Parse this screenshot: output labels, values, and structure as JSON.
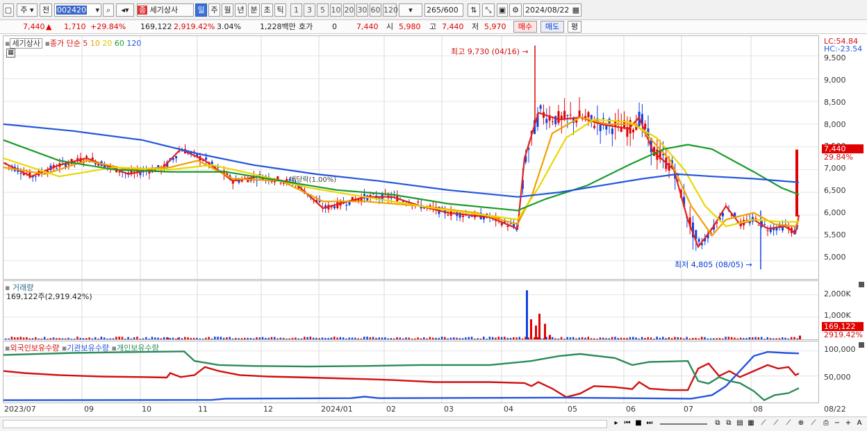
{
  "toolbar": {
    "mode_label": "주",
    "prev_label": "전",
    "code_value": "002420",
    "stock_badge": "종",
    "stock_name": "세기상사",
    "period_tabs": [
      "일",
      "주",
      "월",
      "년",
      "분",
      "초",
      "틱"
    ],
    "selected_period": "일",
    "interval_buttons": [
      "1",
      "3",
      "5",
      "10",
      "20",
      "30",
      "60",
      "120"
    ],
    "count_value": "265",
    "count_total": "/600",
    "date_value": "2024/08/22"
  },
  "quote": {
    "price": "7,440",
    "change": "1,710",
    "change_pct": "+29.84%",
    "volume": "169,122",
    "volume_pct": "2,919.42%",
    "turnover_pct": "3.04%",
    "amount": "1,228백만",
    "hoga_label": "호가",
    "hoga_value": "0",
    "ask_price": "7,440",
    "open_label": "시",
    "open": "5,980",
    "high_label": "고",
    "high": "7,440",
    "low_label": "저",
    "low": "5,970",
    "buy_btn": "매수",
    "sell_btn": "매도",
    "eval_btn": "평"
  },
  "price_panel": {
    "stock_label": "세기상사",
    "legend_prefix": "종가 단순",
    "ma_periods": [
      "5",
      "10",
      "20",
      "60",
      "120"
    ],
    "ma_colors": [
      "#e02020",
      "#f0a000",
      "#e8d800",
      "#1a9a2a",
      "#2255dd"
    ],
    "high_note": "최고 9,730 (04/16)",
    "low_note": "최저 4,805 (08/05)",
    "dividend_note": "배당락(1.00%)",
    "lc_label": "LC:54.84",
    "hc_label": "HC:-23.54",
    "y_ticks": [
      "9,500",
      "9,000",
      "8,500",
      "8,000",
      "7,500",
      "7,000",
      "6,500",
      "6,000",
      "5,500",
      "5,000"
    ],
    "current_tag": "7,440",
    "current_pct": "29.84%"
  },
  "volume_panel": {
    "title": "거래량",
    "subtitle": "169,122주(2,919.42%)",
    "y_ticks": [
      "2,000K",
      "1,000K"
    ],
    "current_tag": "169,122",
    "current_pct": "2919.42%"
  },
  "holding_panel": {
    "legend": [
      "외국인보유수량",
      "기관보유수량",
      "개인보유수량"
    ],
    "legend_colors": [
      "#d01010",
      "#2255dd",
      "#2a8a5a"
    ],
    "y_ticks": [
      "100,000",
      "50,000"
    ]
  },
  "x_axis": {
    "labels": [
      "2023/07",
      "09",
      "10",
      "11",
      "12",
      "2024/01",
      "02",
      "03",
      "04",
      "05",
      "06",
      "07",
      "08"
    ],
    "end_label": "08/22"
  },
  "chart_data": {
    "type": "candlestick",
    "title": "세기상사",
    "ylim": [
      4700,
      9800
    ],
    "ma_series": [
      {
        "name": "5",
        "color": "#e02020",
        "points": [
          [
            0,
            7150
          ],
          [
            40,
            6850
          ],
          [
            80,
            7100
          ],
          [
            120,
            7250
          ],
          [
            180,
            6900
          ],
          [
            230,
            7050
          ],
          [
            255,
            7450
          ],
          [
            290,
            7200
          ],
          [
            330,
            6750
          ],
          [
            370,
            6850
          ],
          [
            420,
            6700
          ],
          [
            460,
            6150
          ],
          [
            520,
            6400
          ],
          [
            560,
            6400
          ],
          [
            600,
            6200
          ],
          [
            640,
            6050
          ],
          [
            700,
            5950
          ],
          [
            740,
            5700
          ],
          [
            750,
            7250
          ],
          [
            770,
            8250
          ],
          [
            800,
            8100
          ],
          [
            830,
            8150
          ],
          [
            860,
            8000
          ],
          [
            900,
            7900
          ],
          [
            915,
            8150
          ],
          [
            935,
            7400
          ],
          [
            965,
            7000
          ],
          [
            985,
            5900
          ],
          [
            1000,
            5300
          ],
          [
            1020,
            5700
          ],
          [
            1040,
            6200
          ],
          [
            1060,
            5800
          ],
          [
            1080,
            5900
          ],
          [
            1100,
            5700
          ],
          [
            1125,
            5750
          ],
          [
            1140,
            5600
          ],
          [
            1145,
            6000
          ]
        ]
      },
      {
        "name": "10",
        "color": "#f0a000",
        "points": [
          [
            0,
            7050
          ],
          [
            60,
            6900
          ],
          [
            120,
            7200
          ],
          [
            180,
            7000
          ],
          [
            240,
            7050
          ],
          [
            280,
            7200
          ],
          [
            330,
            6800
          ],
          [
            400,
            6750
          ],
          [
            460,
            6300
          ],
          [
            520,
            6300
          ],
          [
            600,
            6200
          ],
          [
            680,
            6050
          ],
          [
            740,
            5800
          ],
          [
            760,
            6400
          ],
          [
            790,
            7800
          ],
          [
            830,
            8150
          ],
          [
            870,
            8000
          ],
          [
            910,
            8000
          ],
          [
            930,
            7700
          ],
          [
            960,
            7200
          ],
          [
            990,
            6200
          ],
          [
            1020,
            5550
          ],
          [
            1040,
            5900
          ],
          [
            1080,
            6050
          ],
          [
            1110,
            5800
          ],
          [
            1140,
            5750
          ],
          [
            1145,
            5900
          ]
        ]
      },
      {
        "name": "20",
        "color": "#e8d800",
        "points": [
          [
            0,
            7250
          ],
          [
            80,
            6850
          ],
          [
            160,
            7050
          ],
          [
            240,
            7000
          ],
          [
            300,
            7100
          ],
          [
            360,
            6900
          ],
          [
            440,
            6600
          ],
          [
            520,
            6400
          ],
          [
            620,
            6150
          ],
          [
            740,
            5900
          ],
          [
            770,
            6600
          ],
          [
            810,
            7700
          ],
          [
            850,
            8100
          ],
          [
            900,
            8050
          ],
          [
            940,
            7700
          ],
          [
            980,
            7000
          ],
          [
            1010,
            6200
          ],
          [
            1040,
            5750
          ],
          [
            1080,
            5900
          ],
          [
            1120,
            5850
          ],
          [
            1145,
            5850
          ]
        ]
      },
      {
        "name": "60",
        "color": "#1a9a2a",
        "points": [
          [
            0,
            7650
          ],
          [
            80,
            7200
          ],
          [
            160,
            7000
          ],
          [
            240,
            6950
          ],
          [
            320,
            6950
          ],
          [
            400,
            6750
          ],
          [
            480,
            6550
          ],
          [
            560,
            6450
          ],
          [
            640,
            6250
          ],
          [
            740,
            6100
          ],
          [
            780,
            6350
          ],
          [
            840,
            6650
          ],
          [
            900,
            7100
          ],
          [
            950,
            7450
          ],
          [
            985,
            7550
          ],
          [
            1020,
            7450
          ],
          [
            1080,
            6950
          ],
          [
            1120,
            6600
          ],
          [
            1145,
            6450
          ]
        ]
      },
      {
        "name": "120",
        "color": "#2255dd",
        "points": [
          [
            0,
            8000
          ],
          [
            100,
            7850
          ],
          [
            200,
            7650
          ],
          [
            280,
            7350
          ],
          [
            360,
            7100
          ],
          [
            450,
            6900
          ],
          [
            540,
            6750
          ],
          [
            640,
            6550
          ],
          [
            740,
            6400
          ],
          [
            800,
            6500
          ],
          [
            860,
            6650
          ],
          [
            920,
            6800
          ],
          [
            970,
            6900
          ],
          [
            1020,
            6850
          ],
          [
            1080,
            6800
          ],
          [
            1145,
            6720
          ]
        ]
      }
    ],
    "volume_spikes": [
      [
        235,
        80
      ],
      [
        250,
        50
      ],
      [
        752,
        2200
      ],
      [
        758,
        900
      ],
      [
        765,
        620
      ],
      [
        770,
        1150
      ],
      [
        778,
        700
      ],
      [
        785,
        200
      ],
      [
        1145,
        169
      ]
    ],
    "holding_series": [
      {
        "name": "외국인보유수량",
        "color": "#d01010",
        "points": [
          [
            0,
            60000
          ],
          [
            30,
            56000
          ],
          [
            80,
            52000
          ],
          [
            140,
            49000
          ],
          [
            200,
            48000
          ],
          [
            235,
            47000
          ],
          [
            240,
            56000
          ],
          [
            255,
            48000
          ],
          [
            275,
            52000
          ],
          [
            290,
            68000
          ],
          [
            310,
            60000
          ],
          [
            340,
            52000
          ],
          [
            380,
            49000
          ],
          [
            440,
            47000
          ],
          [
            520,
            44000
          ],
          [
            560,
            42000
          ],
          [
            620,
            38000
          ],
          [
            700,
            38000
          ],
          [
            750,
            36000
          ],
          [
            760,
            30000
          ],
          [
            770,
            38000
          ],
          [
            790,
            25000
          ],
          [
            810,
            8000
          ],
          [
            830,
            15000
          ],
          [
            850,
            30000
          ],
          [
            880,
            28000
          ],
          [
            905,
            24000
          ],
          [
            915,
            38000
          ],
          [
            930,
            25000
          ],
          [
            960,
            22000
          ],
          [
            985,
            22000
          ],
          [
            1000,
            65000
          ],
          [
            1015,
            75000
          ],
          [
            1030,
            50000
          ],
          [
            1045,
            60000
          ],
          [
            1060,
            48000
          ],
          [
            1080,
            60000
          ],
          [
            1100,
            72000
          ],
          [
            1115,
            65000
          ],
          [
            1130,
            68000
          ],
          [
            1140,
            52000
          ],
          [
            1145,
            55000
          ]
        ]
      },
      {
        "name": "기관보유수량",
        "color": "#2255dd",
        "points": [
          [
            0,
            2000
          ],
          [
            300,
            2500
          ],
          [
            320,
            5000
          ],
          [
            500,
            6000
          ],
          [
            520,
            9000
          ],
          [
            540,
            6000
          ],
          [
            800,
            7000
          ],
          [
            990,
            5000
          ],
          [
            1020,
            12000
          ],
          [
            1040,
            30000
          ],
          [
            1060,
            60000
          ],
          [
            1080,
            90000
          ],
          [
            1100,
            98000
          ],
          [
            1125,
            96000
          ],
          [
            1145,
            95000
          ]
        ]
      },
      {
        "name": "개인보유수량",
        "color": "#2a8a5a",
        "points": [
          [
            0,
            92000
          ],
          [
            100,
            96000
          ],
          [
            200,
            98000
          ],
          [
            260,
            99000
          ],
          [
            275,
            80000
          ],
          [
            310,
            72000
          ],
          [
            360,
            70000
          ],
          [
            440,
            69000
          ],
          [
            520,
            70000
          ],
          [
            600,
            72000
          ],
          [
            700,
            72000
          ],
          [
            760,
            80000
          ],
          [
            800,
            90000
          ],
          [
            830,
            94000
          ],
          [
            880,
            86000
          ],
          [
            905,
            72000
          ],
          [
            930,
            78000
          ],
          [
            960,
            79000
          ],
          [
            985,
            80000
          ],
          [
            1000,
            40000
          ],
          [
            1015,
            35000
          ],
          [
            1030,
            48000
          ],
          [
            1045,
            40000
          ],
          [
            1060,
            36000
          ],
          [
            1080,
            20000
          ],
          [
            1095,
            2000
          ],
          [
            1110,
            12000
          ],
          [
            1130,
            16000
          ],
          [
            1145,
            26000
          ]
        ]
      }
    ]
  }
}
